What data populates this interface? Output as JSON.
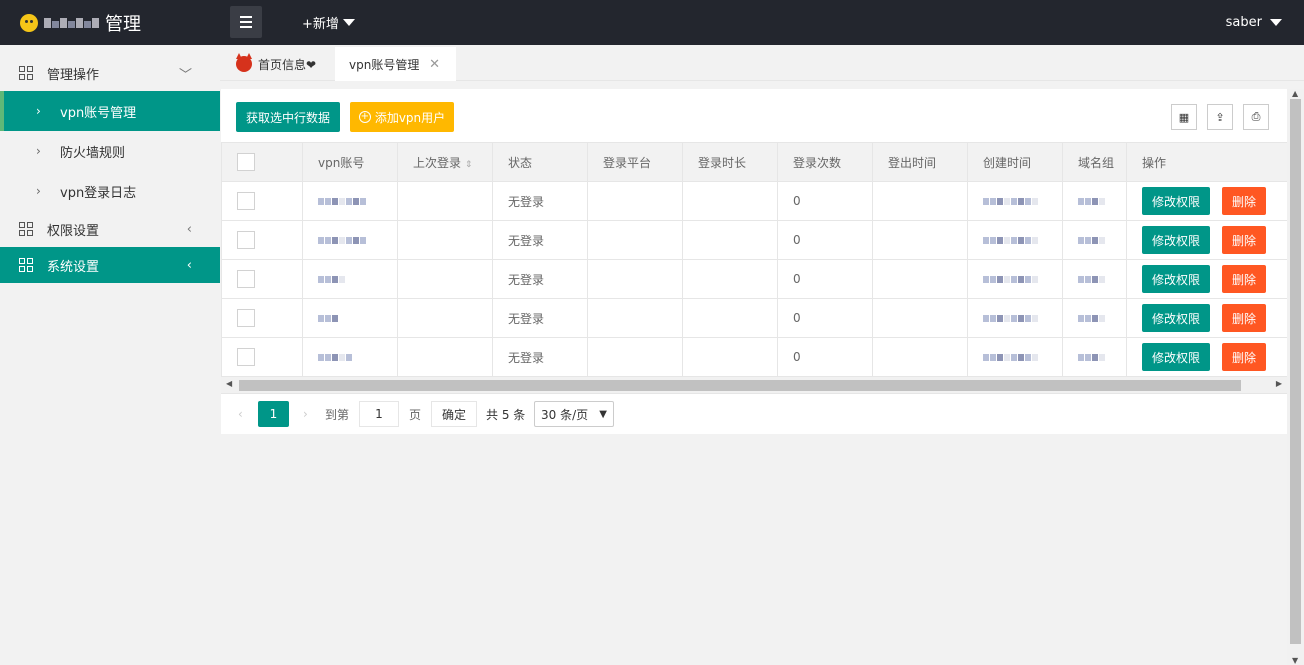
{
  "header": {
    "app_title": "管理",
    "add_new": "+新增",
    "user": "saber"
  },
  "sidebar": {
    "groups": [
      {
        "label": "管理操作"
      },
      {
        "label": "权限设置"
      },
      {
        "label": "系统设置"
      }
    ],
    "sub_items": [
      {
        "label": "vpn账号管理"
      },
      {
        "label": "防火墙规则"
      },
      {
        "label": "vpn登录日志"
      }
    ]
  },
  "tabs": [
    {
      "label": "首页信息❤"
    },
    {
      "label": "vpn账号管理"
    }
  ],
  "toolbar": {
    "get_selected": "获取选中行数据",
    "add_vpn_user": "添加vpn用户"
  },
  "table": {
    "columns": [
      "vpn账号",
      "上次登录",
      "状态",
      "登录平台",
      "登录时长",
      "登录次数",
      "登出时间",
      "创建时间",
      "域名组",
      "操作"
    ],
    "rows": [
      {
        "status": "无登录",
        "login_count": "0"
      },
      {
        "status": "无登录",
        "login_count": "0"
      },
      {
        "status": "无登录",
        "login_count": "0"
      },
      {
        "status": "无登录",
        "login_count": "0"
      },
      {
        "status": "无登录",
        "login_count": "0"
      }
    ],
    "edit_label": "修改权限",
    "delete_label": "删除"
  },
  "pager": {
    "current": "1",
    "goto": "到第",
    "input_value": "1",
    "page": "页",
    "confirm": "确定",
    "total": "共 5 条",
    "page_size": "30 条/页"
  }
}
